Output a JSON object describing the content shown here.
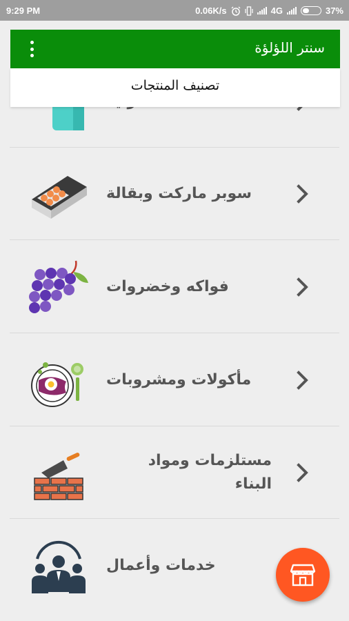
{
  "status": {
    "time": "9:29 PM",
    "network_speed": "0.06K/s",
    "network_type": "4G",
    "battery": "37%"
  },
  "toolbar": {
    "title": "سنتر اللؤلؤة",
    "menu_icon": "overflow-menu-icon"
  },
  "subheader": {
    "label": "تصنيف المنتجات"
  },
  "categories": [
    {
      "label": "منزلية",
      "icon": "household-icon"
    },
    {
      "label": "سوبر ماركت وبقالة",
      "icon": "egg-carton-icon"
    },
    {
      "label": "فواكه وخضروات",
      "icon": "grapes-icon"
    },
    {
      "label": "مأكولات ومشروبات",
      "icon": "breakfast-plate-icon"
    },
    {
      "label": "مستلزمات ومواد البناء",
      "icon": "brick-wall-trowel-icon"
    },
    {
      "label": "خدمات وأعمال",
      "icon": "business-team-icon"
    }
  ],
  "fab": {
    "icon": "store-icon"
  },
  "colors": {
    "toolbar": "#0a8d0a",
    "fab": "#ff5722",
    "statusbar": "#9e9e9e",
    "label": "#555555"
  }
}
